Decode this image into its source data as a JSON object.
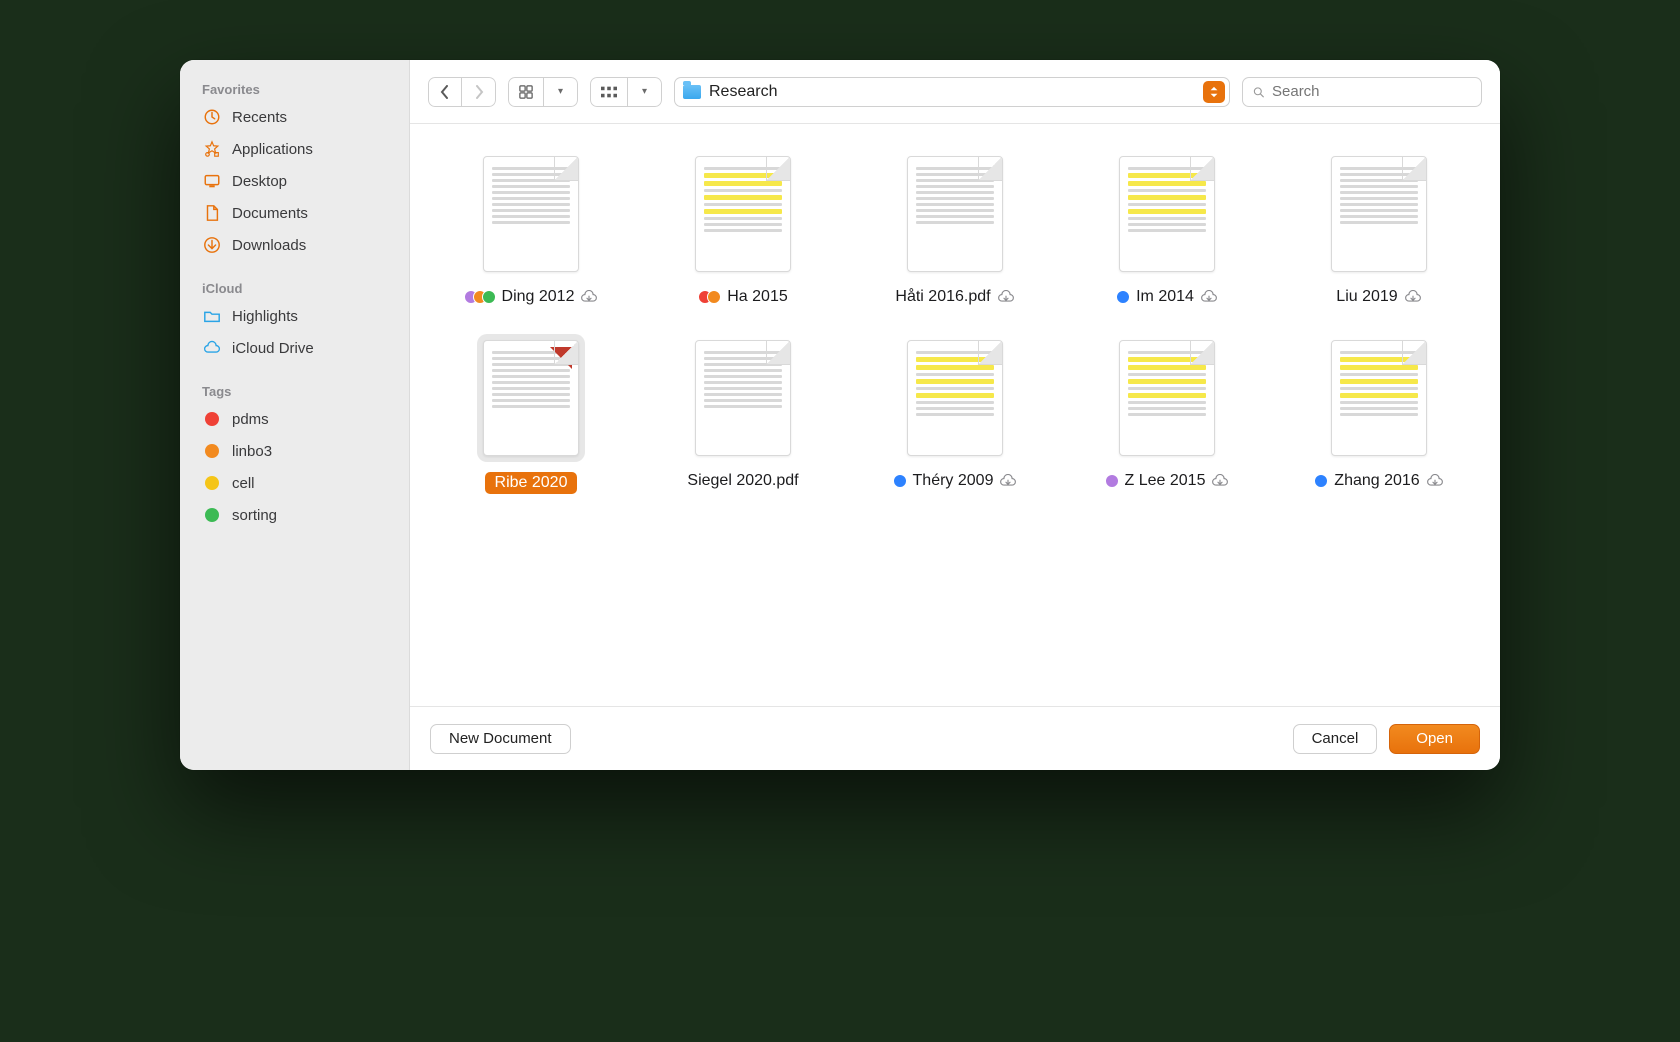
{
  "sidebar": {
    "favorites_title": "Favorites",
    "favorites": [
      {
        "label": "Recents",
        "icon": "clock"
      },
      {
        "label": "Applications",
        "icon": "apps"
      },
      {
        "label": "Desktop",
        "icon": "desktop"
      },
      {
        "label": "Documents",
        "icon": "document"
      },
      {
        "label": "Downloads",
        "icon": "download"
      }
    ],
    "icloud_title": "iCloud",
    "icloud": [
      {
        "label": "Highlights",
        "icon": "folder"
      },
      {
        "label": "iCloud Drive",
        "icon": "cloud"
      }
    ],
    "tags_title": "Tags",
    "tags": [
      {
        "label": "pdms",
        "color": "#ef4136"
      },
      {
        "label": "linbo3",
        "color": "#f28a1f"
      },
      {
        "label": "cell",
        "color": "#f5c518"
      },
      {
        "label": "sorting",
        "color": "#3cba54"
      }
    ]
  },
  "toolbar": {
    "location_name": "Research",
    "search_placeholder": "Search"
  },
  "files": [
    {
      "name": "Ding 2012",
      "tags": [
        "#b27be0",
        "#f28a1f",
        "#3cba54"
      ],
      "cloud": true,
      "highlighted": false,
      "selected": false
    },
    {
      "name": "Ha 2015",
      "tags": [
        "#ef4136",
        "#f28a1f"
      ],
      "cloud": false,
      "highlighted": true,
      "selected": false
    },
    {
      "name": "Håti 2016.pdf",
      "tags": [],
      "cloud": true,
      "highlighted": false,
      "selected": false
    },
    {
      "name": "Im 2014",
      "tags": [
        "#2d82ff"
      ],
      "cloud": true,
      "highlighted": true,
      "selected": false
    },
    {
      "name": "Liu 2019",
      "tags": [],
      "cloud": true,
      "highlighted": false,
      "selected": false
    },
    {
      "name": "Ribe 2020",
      "tags": [],
      "cloud": false,
      "highlighted": false,
      "selected": true
    },
    {
      "name": "Siegel 2020.pdf",
      "tags": [],
      "cloud": false,
      "highlighted": false,
      "selected": false
    },
    {
      "name": "Théry 2009",
      "tags": [
        "#2d82ff"
      ],
      "cloud": true,
      "highlighted": true,
      "selected": false
    },
    {
      "name": "Z Lee 2015",
      "tags": [
        "#b27be0"
      ],
      "cloud": true,
      "highlighted": true,
      "selected": false
    },
    {
      "name": "Zhang 2016",
      "tags": [
        "#2d82ff"
      ],
      "cloud": true,
      "highlighted": true,
      "selected": false
    }
  ],
  "footer": {
    "new_document": "New Document",
    "cancel": "Cancel",
    "open": "Open"
  },
  "colors": {
    "accent": "#e8720c"
  }
}
